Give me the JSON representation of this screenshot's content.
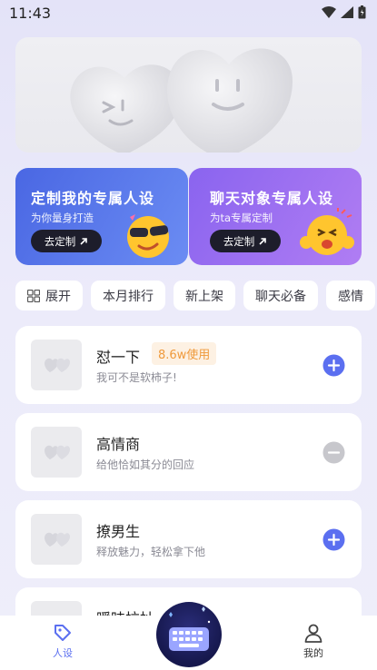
{
  "status_bar": {
    "time": "11:43"
  },
  "cards": [
    {
      "title": "定制我的专属人设",
      "subtitle": "为你量身打造",
      "button": "去定制"
    },
    {
      "title": "聊天对象专属人设",
      "subtitle": "为ta专属定制",
      "button": "去定制"
    }
  ],
  "chips": [
    "展开",
    "本月排行",
    "新上架",
    "聊天必备",
    "感情"
  ],
  "items": [
    {
      "title": "怼一下",
      "badge": "8.6w使用",
      "desc": "我可不是软柿子!",
      "action": "add"
    },
    {
      "title": "高情商",
      "desc": "给他恰如其分的回应",
      "action": "remove"
    },
    {
      "title": "撩男生",
      "desc": "释放魅力，轻松拿下他",
      "action": "add"
    },
    {
      "title": "暧昧拉扯",
      "desc": "",
      "action": "add"
    }
  ],
  "nav": {
    "persona": "人设",
    "mine": "我的"
  },
  "colors": {
    "accent": "#5b6ff0",
    "badge": "#ef9a3c"
  }
}
